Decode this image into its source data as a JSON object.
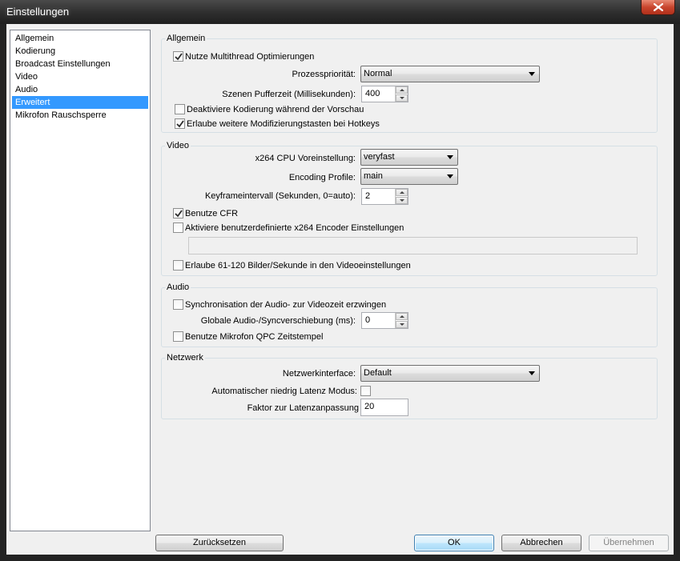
{
  "window": {
    "title": "Einstellungen"
  },
  "sidebar": {
    "items": [
      {
        "label": "Allgemein",
        "selected": false
      },
      {
        "label": "Kodierung",
        "selected": false
      },
      {
        "label": "Broadcast Einstellungen",
        "selected": false
      },
      {
        "label": "Video",
        "selected": false
      },
      {
        "label": "Audio",
        "selected": false
      },
      {
        "label": "Erweitert",
        "selected": true
      },
      {
        "label": "Mikrofon Rauschsperre",
        "selected": false
      }
    ]
  },
  "allgemein": {
    "title": "Allgemein",
    "multithread_label": "Nutze Multithread Optimierungen",
    "multithread_checked": true,
    "priority_label": "Prozesspriorität:",
    "priority_value": "Normal",
    "buffer_label": "Szenen Pufferzeit (Millisekunden):",
    "buffer_value": "400",
    "disable_encoding_label": "Deaktiviere Kodierung während der Vorschau",
    "disable_encoding_checked": false,
    "hotkeys_label": "Erlaube weitere Modifizierungstasten bei Hotkeys",
    "hotkeys_checked": true
  },
  "video": {
    "title": "Video",
    "preset_label": "x264 CPU Voreinstellung:",
    "preset_value": "veryfast",
    "profile_label": "Encoding Profile:",
    "profile_value": "main",
    "keyframe_label": "Keyframeintervall (Sekunden, 0=auto):",
    "keyframe_value": "2",
    "cfr_label": "Benutze CFR",
    "cfr_checked": true,
    "custom_x264_label": "Aktiviere benutzerdefinierte x264 Encoder Einstellungen",
    "custom_x264_checked": false,
    "custom_x264_value": "",
    "highfps_label": "Erlaube 61-120 Bilder/Sekunde in den Videoeinstellungen",
    "highfps_checked": false
  },
  "audio": {
    "title": "Audio",
    "sync_label": "Synchronisation der Audio- zur Videozeit erzwingen",
    "sync_checked": false,
    "offset_label": "Globale Audio-/Syncverschiebung (ms):",
    "offset_value": "0",
    "qpc_label": "Benutze Mikrofon QPC Zeitstempel",
    "qpc_checked": false
  },
  "netzwerk": {
    "title": "Netzwerk",
    "interface_label": "Netzwerkinterface:",
    "interface_value": "Default",
    "latency_mode_label": "Automatischer niedrig Latenz Modus:",
    "latency_mode_checked": false,
    "latency_factor_label": "Faktor zur Latenzanpassung",
    "latency_factor_value": "20"
  },
  "buttons": {
    "reset": "Zurücksetzen",
    "ok": "OK",
    "cancel": "Abbrechen",
    "apply": "Übernehmen"
  },
  "colors": {
    "selection": "#3399ff",
    "default_button_border": "#3c7fb1",
    "close_button": "#c8452d"
  }
}
